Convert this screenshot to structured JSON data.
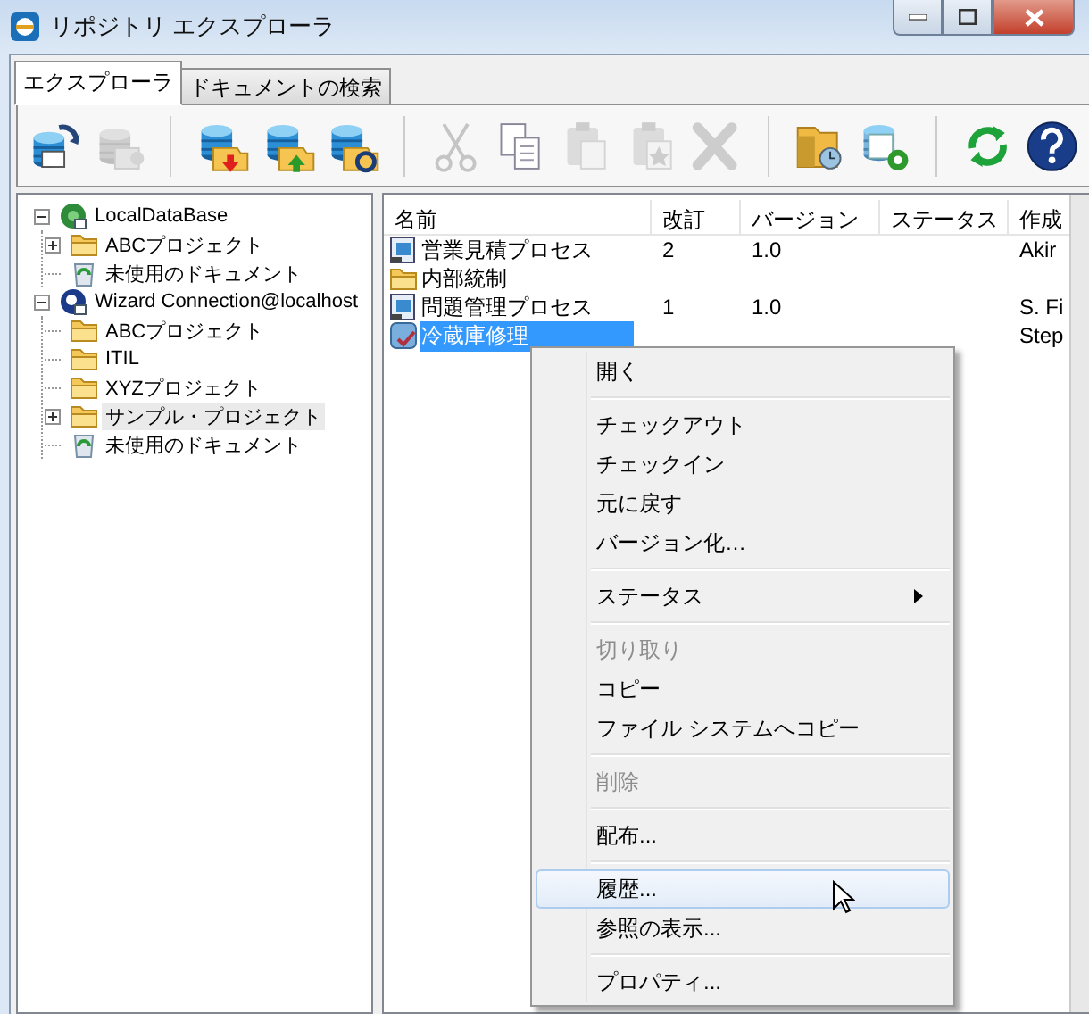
{
  "window": {
    "title": "リポジトリ エクスプローラ"
  },
  "tabs": [
    {
      "label": "エクスプローラ",
      "selected": true
    },
    {
      "label": "ドキュメントの検索",
      "selected": false
    }
  ],
  "toolbar": {
    "groups": [
      [
        {
          "disabled": false
        },
        {
          "disabled": true
        }
      ],
      [
        {
          "disabled": false
        },
        {
          "disabled": false
        },
        {
          "disabled": false
        }
      ],
      [
        {
          "disabled": true
        },
        {
          "disabled": false
        },
        {
          "disabled": true
        },
        {
          "disabled": true
        },
        {
          "disabled": true
        }
      ],
      [
        {
          "disabled": false
        },
        {
          "disabled": false
        }
      ],
      [
        {
          "disabled": false
        },
        {
          "disabled": false
        }
      ]
    ]
  },
  "tree": [
    {
      "label": "LocalDataBase",
      "kind": "database",
      "expanded": true,
      "selected": false,
      "children": [
        {
          "label": "ABCプロジェクト",
          "kind": "folder",
          "expanded": false,
          "selected": false
        },
        {
          "label": "未使用のドキュメント",
          "kind": "recycle",
          "selected": false
        }
      ]
    },
    {
      "label": "Wizard Connection@localhost",
      "kind": "connection",
      "expanded": true,
      "selected": false,
      "children": [
        {
          "label": "ABCプロジェクト",
          "kind": "folder",
          "selected": false
        },
        {
          "label": "ITIL",
          "kind": "folder",
          "selected": false
        },
        {
          "label": "XYZプロジェクト",
          "kind": "folder",
          "selected": false
        },
        {
          "label": "サンプル・プロジェクト",
          "kind": "folder",
          "expanded": false,
          "selected": true
        },
        {
          "label": "未使用のドキュメント",
          "kind": "recycle",
          "selected": false
        }
      ]
    }
  ],
  "table": {
    "columns": [
      "名前",
      "改訂",
      "バージョン",
      "ステータス",
      "作成"
    ],
    "rows": [
      {
        "kind": "process",
        "name": "営業見積プロセス",
        "revision": "2",
        "version": "1.0",
        "author": "Akir",
        "selected": false
      },
      {
        "kind": "folder",
        "name": "内部統制",
        "selected": false
      },
      {
        "kind": "process",
        "name": "問題管理プロセス",
        "revision": "1",
        "version": "1.0",
        "author": "S. Fi",
        "selected": false
      },
      {
        "kind": "service",
        "name": "冷蔵庫修理",
        "author": "Step",
        "selected": true
      }
    ]
  },
  "context_menu": {
    "groups": [
      [
        {
          "label": "開く",
          "disabled": false,
          "submenu": false,
          "selected": false
        }
      ],
      [
        {
          "label": "チェックアウト",
          "disabled": false,
          "submenu": false,
          "selected": false
        },
        {
          "label": "チェックイン",
          "disabled": false,
          "submenu": false,
          "selected": false
        },
        {
          "label": "元に戻す",
          "disabled": false,
          "submenu": false,
          "selected": false
        },
        {
          "label": "バージョン化…",
          "disabled": false,
          "submenu": false,
          "selected": false
        }
      ],
      [
        {
          "label": "ステータス",
          "disabled": false,
          "submenu": true,
          "selected": false
        }
      ],
      [
        {
          "label": "切り取り",
          "disabled": true,
          "submenu": false,
          "selected": false
        },
        {
          "label": "コピー",
          "disabled": false,
          "submenu": false,
          "selected": false
        },
        {
          "label": "ファイル システムへコピー",
          "disabled": false,
          "submenu": false,
          "selected": false
        }
      ],
      [
        {
          "label": "削除",
          "disabled": true,
          "submenu": false,
          "selected": false
        }
      ],
      [
        {
          "label": "配布...",
          "disabled": false,
          "submenu": false,
          "selected": false
        }
      ],
      [
        {
          "label": "履歴...",
          "disabled": false,
          "submenu": false,
          "selected": true
        },
        {
          "label": "参照の表示...",
          "disabled": false,
          "submenu": false,
          "selected": false
        }
      ],
      [
        {
          "label": "プロパティ...",
          "disabled": false,
          "submenu": false,
          "selected": false
        }
      ]
    ]
  }
}
